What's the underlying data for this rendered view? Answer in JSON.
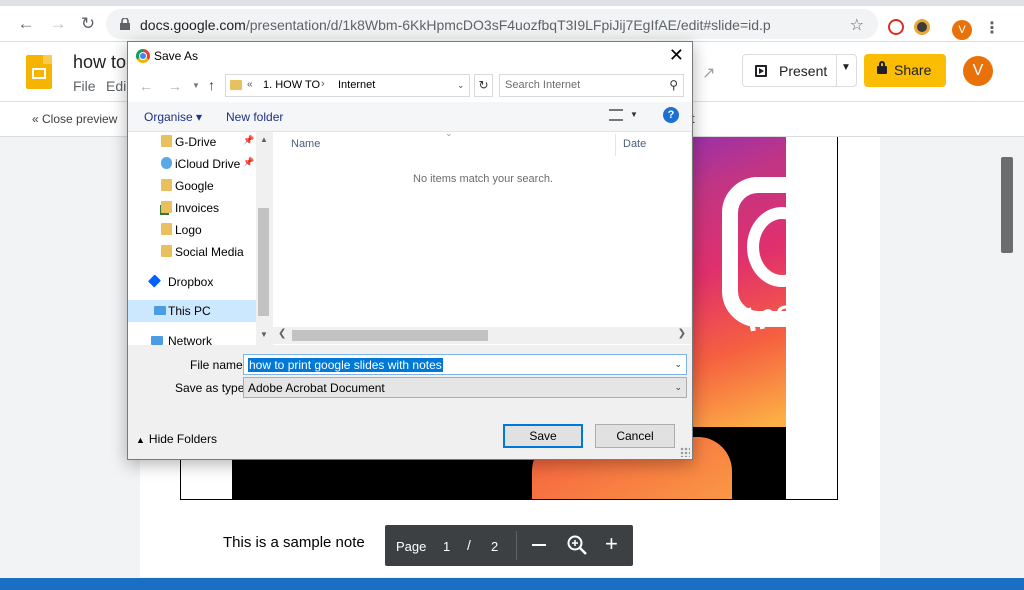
{
  "browser": {
    "url_host": "docs.google.com",
    "url_path": "/presentation/d/1k8Wbm-6KkHpmcDO3sF4uozfbqT3I9LFpiJij7EgIfAE/edit#slide=id.p",
    "avatar_letter": "V"
  },
  "app": {
    "title": "how to",
    "menu_file": "File",
    "menu_edit": "Edi",
    "present_label": "Present",
    "share_label": "Share",
    "avatar_letter": "V"
  },
  "preview_toolbar": {
    "close_preview": "« Close preview",
    "partial_text": "t"
  },
  "slide": {
    "watermark_word": "Ins",
    "note": "This is a sample note"
  },
  "pager": {
    "label": "Page",
    "current": "1",
    "separator": "/",
    "total": "2"
  },
  "dialog": {
    "title": "Save As",
    "address": {
      "chevron": "«",
      "path": [
        "1. HOW TO",
        "Internet"
      ]
    },
    "search_placeholder": "Search Internet",
    "organise": "Organise ▾",
    "new_folder": "New folder",
    "nav_items": [
      {
        "label": "G-Drive",
        "pinned": true,
        "icon": "folder-icon"
      },
      {
        "label": "iCloud Drive",
        "pinned": true,
        "icon": "icloud-icon"
      },
      {
        "label": "Google",
        "pinned": false,
        "icon": "folder-icon"
      },
      {
        "label": "Invoices",
        "pinned": false,
        "icon": "folder-icon"
      },
      {
        "label": "Logo",
        "pinned": false,
        "icon": "folder-icon"
      },
      {
        "label": "Social Media",
        "pinned": false,
        "icon": "folder-icon"
      },
      {
        "label": "Dropbox",
        "pinned": false,
        "icon": "dropbox-icon"
      },
      {
        "label": "This PC",
        "pinned": false,
        "icon": "pc-icon",
        "selected": true
      },
      {
        "label": "Network",
        "pinned": false,
        "icon": "network-icon"
      }
    ],
    "columns": {
      "name": "Name",
      "date": "Date"
    },
    "empty_message": "No items match your search.",
    "file_name_label": "File name:",
    "file_name_value": "how to print google slides with notes",
    "save_type_label": "Save as type:",
    "save_type_value": "Adobe Acrobat Document",
    "hide_folders": "Hide Folders",
    "save_button": "Save",
    "cancel_button": "Cancel"
  },
  "colors": {
    "slides_yellow": "#f4b400",
    "share_button": "#fbbc04",
    "avatar": "#e8710a",
    "dialog_selection": "#0078d7"
  }
}
